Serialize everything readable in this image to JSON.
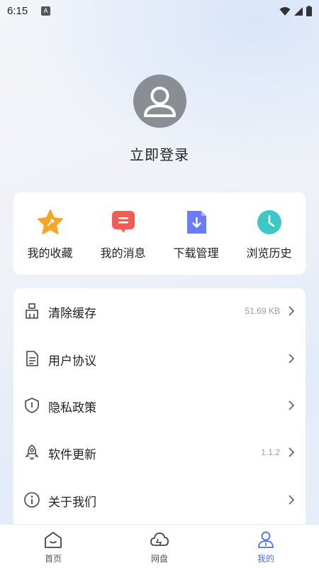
{
  "status_bar": {
    "time": "6:15",
    "notification_badge": "A"
  },
  "profile": {
    "login_text": "立即登录"
  },
  "quick_actions": [
    {
      "label": "我的收藏",
      "icon": "star-icon"
    },
    {
      "label": "我的消息",
      "icon": "message-icon"
    },
    {
      "label": "下载管理",
      "icon": "download-icon"
    },
    {
      "label": "浏览历史",
      "icon": "clock-icon"
    }
  ],
  "settings": [
    {
      "label": "清除缓存",
      "value": "51.69 KB",
      "icon": "broom-icon"
    },
    {
      "label": "用户协议",
      "value": "",
      "icon": "document-icon"
    },
    {
      "label": "隐私政策",
      "value": "",
      "icon": "shield-icon"
    },
    {
      "label": "软件更新",
      "value": "1.1.2",
      "icon": "rocket-icon"
    },
    {
      "label": "关于我们",
      "value": "",
      "icon": "info-icon"
    }
  ],
  "bottom_nav": [
    {
      "label": "首页",
      "icon": "home-icon",
      "active": false
    },
    {
      "label": "网盘",
      "icon": "cloud-icon",
      "active": false
    },
    {
      "label": "我的",
      "icon": "user-icon",
      "active": true
    }
  ],
  "colors": {
    "accent": "#4a6ff0",
    "star": "#f5a623",
    "message": "#f25c54",
    "download": "#6b7cf5",
    "clock": "#3fc7c7"
  }
}
